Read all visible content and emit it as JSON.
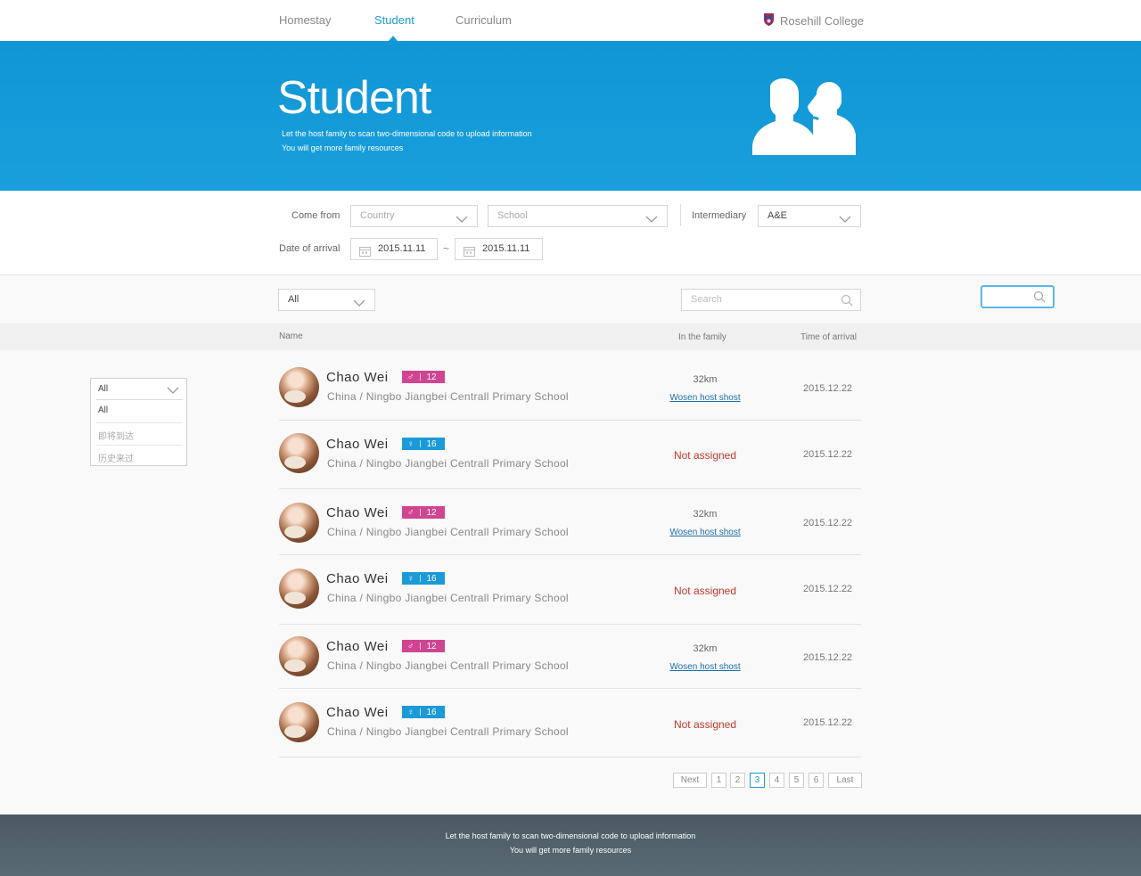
{
  "nav": {
    "homestay": "Homestay",
    "student": "Student",
    "curriculum": "Curriculum",
    "college": "Rosehill College"
  },
  "hero": {
    "title": "Student",
    "line1": "Let the host family to scan two-dimensional code to upload information",
    "line2": "You will get more family resources"
  },
  "filters": {
    "come_from_label": "Come from",
    "country_placeholder": "Country",
    "school_placeholder": "School",
    "intermediary_label": "Intermediary",
    "intermediary_value": "A&E",
    "date_label": "Date of arrival",
    "date_from": "2015.11.11",
    "date_separator": "~",
    "date_to": "2015.11.11"
  },
  "toolbar": {
    "status_value": "All",
    "search_placeholder": "Search"
  },
  "table": {
    "headers": {
      "name": "Name",
      "in_family": "In the family",
      "time": "Time of arrival"
    }
  },
  "rows": [
    {
      "name": "Chao  Wei",
      "gender": "♂",
      "age": "12",
      "origin": "China  /  Ningbo Jiangbei Centrall Primary School",
      "distance": "32km",
      "host": "Wosen host shost",
      "status": "",
      "date": "2015.12.22"
    },
    {
      "name": "Chao  Wei",
      "gender": "♀",
      "age": "16",
      "origin": "China  /  Ningbo Jiangbei Centrall Primary School",
      "distance": "",
      "host": "",
      "status": "Not assigned",
      "date": "2015.12.22"
    },
    {
      "name": "Chao  Wei",
      "gender": "♂",
      "age": "12",
      "origin": "China  /  Ningbo Jiangbei Centrall Primary School",
      "distance": "32km",
      "host": "Wosen host shost",
      "status": "",
      "date": "2015.12.22"
    },
    {
      "name": "Chao  Wei",
      "gender": "♀",
      "age": "16",
      "origin": "China  /  Ningbo Jiangbei Centrall Primary School",
      "distance": "",
      "host": "",
      "status": "Not assigned",
      "date": "2015.12.22"
    },
    {
      "name": "Chao  Wei",
      "gender": "♂",
      "age": "12",
      "origin": "China  /  Ningbo Jiangbei Centrall Primary School",
      "distance": "32km",
      "host": "Wosen host shost",
      "status": "",
      "date": "2015.12.22"
    },
    {
      "name": "Chao  Wei",
      "gender": "♀",
      "age": "16",
      "origin": "China  /  Ningbo Jiangbei Centrall Primary School",
      "distance": "",
      "host": "",
      "status": "Not assigned",
      "date": "2015.12.22"
    }
  ],
  "pagination": {
    "next": "Next",
    "pages": [
      "1",
      "2",
      "3",
      "4",
      "5",
      "6"
    ],
    "current": "3",
    "last": "Last"
  },
  "dropdown": {
    "selected": "All",
    "options": [
      "All",
      "即将到达",
      "历史来过"
    ]
  },
  "footer": {
    "line1": "Let the host family to scan two-dimensional code to upload information",
    "line2": "You will get more family resources"
  },
  "colors": {
    "accent": "#1a9ad6",
    "female_badge": "#d04590",
    "male_badge": "#1a9ad6",
    "not_assigned": "#c0392b",
    "footer": "#4b5a64"
  }
}
